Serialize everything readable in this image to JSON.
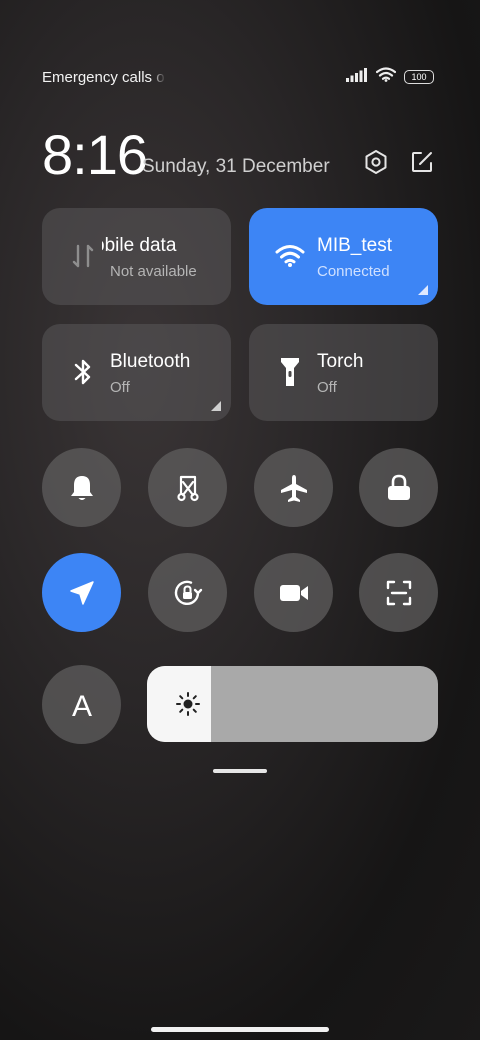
{
  "status": {
    "carrier": "Emergency calls o",
    "battery": "100"
  },
  "header": {
    "time": "8:16",
    "date": "Sunday, 31 December"
  },
  "tiles": [
    {
      "title": "obile data",
      "subtitle": "Not available",
      "icon": "mobile-data-icon",
      "active": false
    },
    {
      "title": "MIB_test",
      "subtitle": "Connected",
      "icon": "wifi-icon",
      "active": true
    },
    {
      "title": "Bluetooth",
      "subtitle": "Off",
      "icon": "bluetooth-icon",
      "active": false
    },
    {
      "title": "Torch",
      "subtitle": "Off",
      "icon": "torch-icon",
      "active": false
    }
  ],
  "toggles": [
    {
      "icon": "bell-icon",
      "active": false
    },
    {
      "icon": "screenshot-icon",
      "active": false
    },
    {
      "icon": "airplane-icon",
      "active": false
    },
    {
      "icon": "lock-icon",
      "active": false
    },
    {
      "icon": "location-icon",
      "active": true
    },
    {
      "icon": "rotation-lock-icon",
      "active": false
    },
    {
      "icon": "video-camera-icon",
      "active": false
    },
    {
      "icon": "scanner-icon",
      "active": false
    },
    {
      "icon": "font-icon",
      "active": false,
      "label": "A"
    }
  ],
  "brightness": {
    "level": 0.22,
    "icon": "sun-icon"
  },
  "colors": {
    "accent": "#3d85f5",
    "tile": "#4a4849",
    "brightness_track": "#a9a9a9"
  }
}
